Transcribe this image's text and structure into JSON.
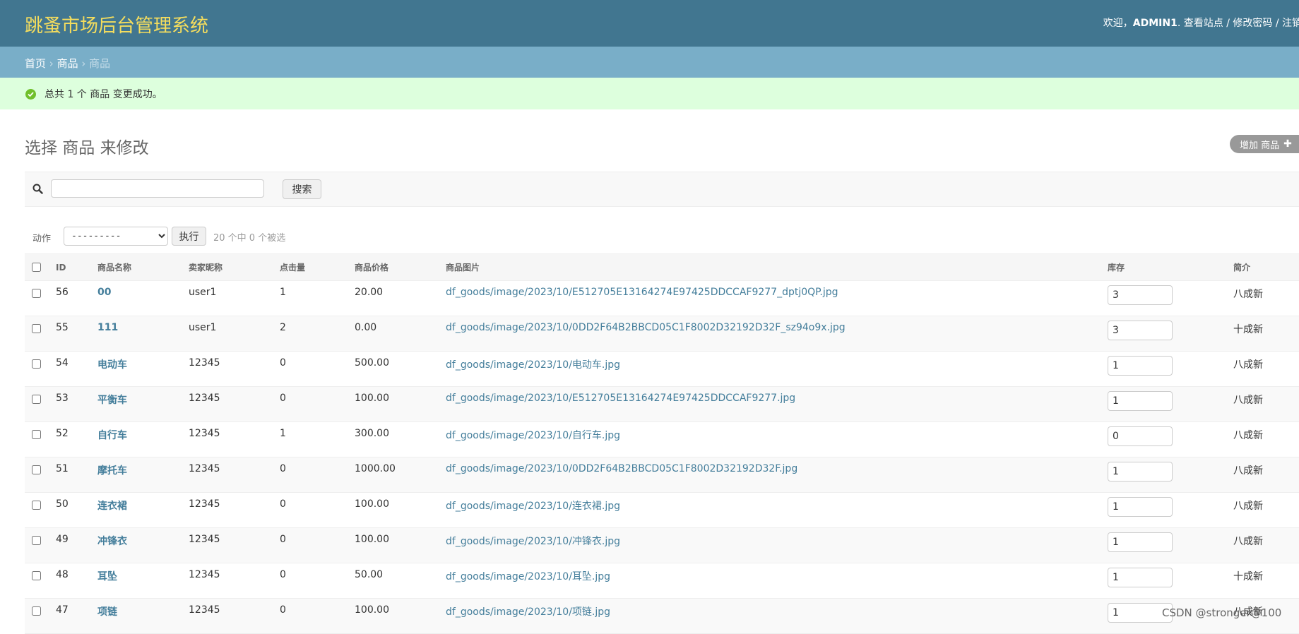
{
  "header": {
    "site_title": "跳蚤市场后台管理系统",
    "welcome": "欢迎，",
    "username": "ADMIN1",
    "view_site": "查看站点",
    "change_password": "修改密码",
    "logout": "注销"
  },
  "breadcrumbs": {
    "home": "首页",
    "app": "商品",
    "current": "商品"
  },
  "message": "总共 1 个 商品 变更成功。",
  "page_title": "选择 商品 来修改",
  "add_button": "增加 商品",
  "search": {
    "value": "",
    "button": "搜索"
  },
  "actions": {
    "label": "动作",
    "selected": "---------",
    "go": "执行",
    "counter": "20 个中 0 个被选"
  },
  "columns": [
    "ID",
    "商品名称",
    "卖家昵称",
    "点击量",
    "商品价格",
    "商品图片",
    "库存",
    "简介"
  ],
  "rows": [
    {
      "id": "56",
      "name": "00",
      "seller": "user1",
      "clicks": "1",
      "price": "20.00",
      "image": "df_goods/image/2023/10/E512705E13164274E97425DDCCAF9277_dptj0QP.jpg",
      "stock": "3",
      "desc": "八成新"
    },
    {
      "id": "55",
      "name": "111",
      "seller": "user1",
      "clicks": "2",
      "price": "0.00",
      "image": "df_goods/image/2023/10/0DD2F64B2BBCD05C1F8002D32192D32F_sz94o9x.jpg",
      "stock": "3",
      "desc": "十成新"
    },
    {
      "id": "54",
      "name": "电动车",
      "seller": "12345",
      "clicks": "0",
      "price": "500.00",
      "image": "df_goods/image/2023/10/电动车.jpg",
      "stock": "1",
      "desc": "八成新"
    },
    {
      "id": "53",
      "name": "平衡车",
      "seller": "12345",
      "clicks": "0",
      "price": "100.00",
      "image": "df_goods/image/2023/10/E512705E13164274E97425DDCCAF9277.jpg",
      "stock": "1",
      "desc": "八成新"
    },
    {
      "id": "52",
      "name": "自行车",
      "seller": "12345",
      "clicks": "1",
      "price": "300.00",
      "image": "df_goods/image/2023/10/自行车.jpg",
      "stock": "0",
      "desc": "八成新"
    },
    {
      "id": "51",
      "name": "摩托车",
      "seller": "12345",
      "clicks": "0",
      "price": "1000.00",
      "image": "df_goods/image/2023/10/0DD2F64B2BBCD05C1F8002D32192D32F.jpg",
      "stock": "1",
      "desc": "八成新"
    },
    {
      "id": "50",
      "name": "连衣裙",
      "seller": "12345",
      "clicks": "0",
      "price": "100.00",
      "image": "df_goods/image/2023/10/连衣裙.jpg",
      "stock": "1",
      "desc": "八成新"
    },
    {
      "id": "49",
      "name": "冲锋衣",
      "seller": "12345",
      "clicks": "0",
      "price": "100.00",
      "image": "df_goods/image/2023/10/冲锋衣.jpg",
      "stock": "1",
      "desc": "八成新"
    },
    {
      "id": "48",
      "name": "耳坠",
      "seller": "12345",
      "clicks": "0",
      "price": "50.00",
      "image": "df_goods/image/2023/10/耳坠.jpg",
      "stock": "1",
      "desc": "十成新"
    },
    {
      "id": "47",
      "name": "项链",
      "seller": "12345",
      "clicks": "0",
      "price": "100.00",
      "image": "df_goods/image/2023/10/项链.jpg",
      "stock": "1",
      "desc": "八成新"
    }
  ],
  "watermark": "CSDN @stronger@100",
  "colors": {
    "header": "#417690",
    "title": "#f5dd5d",
    "breadcrumbs": "#79aec8",
    "success": "#dfd",
    "link": "#447e9b"
  }
}
